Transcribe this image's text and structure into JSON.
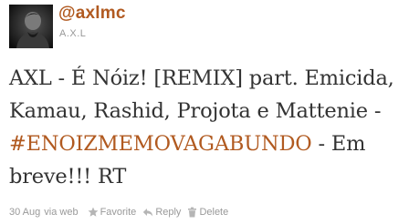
{
  "tweet": {
    "screen_name": "@axlmc",
    "display_name": "A.X.L",
    "text_before_hashtag": "AXL - É Nóiz! [REMIX] part. Emicida, Kamau, Rashid, Projota e Mattenie - ",
    "hashtag": "#ENOIZMEMOVAGABUNDO",
    "text_after_hashtag": " - Em breve!!! RT",
    "timestamp": "30 Aug",
    "via": "via web"
  },
  "actions": {
    "favorite_label": "Favorite",
    "reply_label": "Reply",
    "delete_label": "Delete"
  },
  "icons": {
    "favorite": "star-icon",
    "reply": "reply-arrow-icon",
    "delete": "trash-icon"
  },
  "colors": {
    "link": "#b15a20",
    "text": "#333333",
    "meta": "#999999",
    "background": "#ffffff"
  }
}
